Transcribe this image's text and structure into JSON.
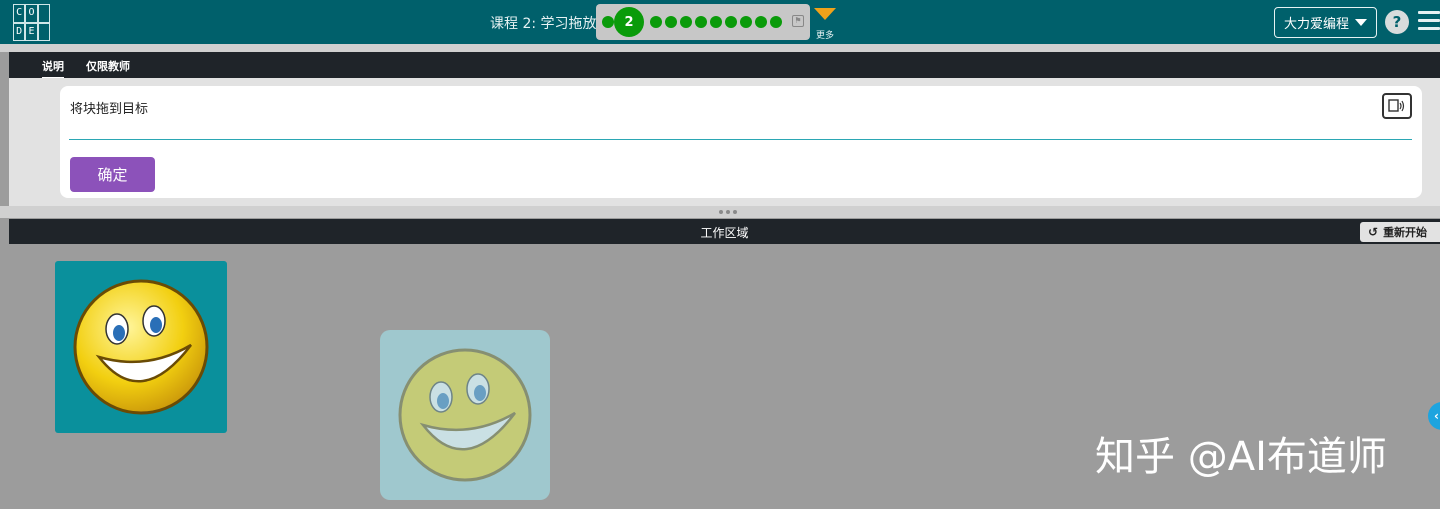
{
  "header": {
    "logo_letters": [
      "C",
      "O",
      "",
      "D",
      "E",
      ""
    ],
    "lesson_title": "课程 2: 学习拖放",
    "current_level": "2",
    "more_label": "更多",
    "user_button": "大力爱编程",
    "help_label": "?"
  },
  "instructions": {
    "tabs": [
      {
        "label": "说明",
        "active": true
      },
      {
        "label": "仅限教师",
        "active": false
      }
    ],
    "text": "将块拖到目标",
    "ok_label": "确定"
  },
  "workspace": {
    "title": "工作区域",
    "restart_label": "重新开始",
    "drag_block_icon": "smiley-face",
    "target_icon": "smiley-face"
  },
  "watermark": "知乎 @AI布道师",
  "colors": {
    "header": "#00606b",
    "progress_dot": "#0a9b0a",
    "ok_button": "#8c52ba",
    "more_arrow": "#f0a21a",
    "drag_block": "#0a909c"
  }
}
